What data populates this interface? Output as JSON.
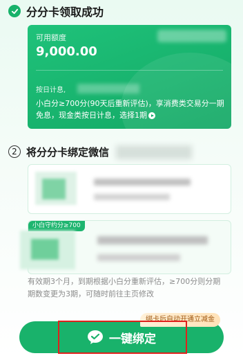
{
  "step1": {
    "title": "分分卡领取成功",
    "icon": "check-circle-icon",
    "accent": "#17b26a"
  },
  "card": {
    "label": "可用额度",
    "amount": "9,000.00",
    "interest_label": "按日计息,",
    "description": "小白分≥700分(90天后重新评估)，享消费类交易分一期免息，现金类按日计息，选择1期",
    "color": "#19b26b"
  },
  "step2": {
    "number": "2",
    "title": "将分分卡绑定微信"
  },
  "options": [
    {
      "tag": ""
    },
    {
      "tag": "小白守约分≥700"
    }
  ],
  "note": "有效期3个月，到期根据小白分重新评估，≥700分则分期期数变更为3期，可随时前往主页修改",
  "promo": "绑卡后自动开通立减金",
  "bind_button": {
    "label": "一键绑定",
    "icon": "wechat-icon"
  }
}
